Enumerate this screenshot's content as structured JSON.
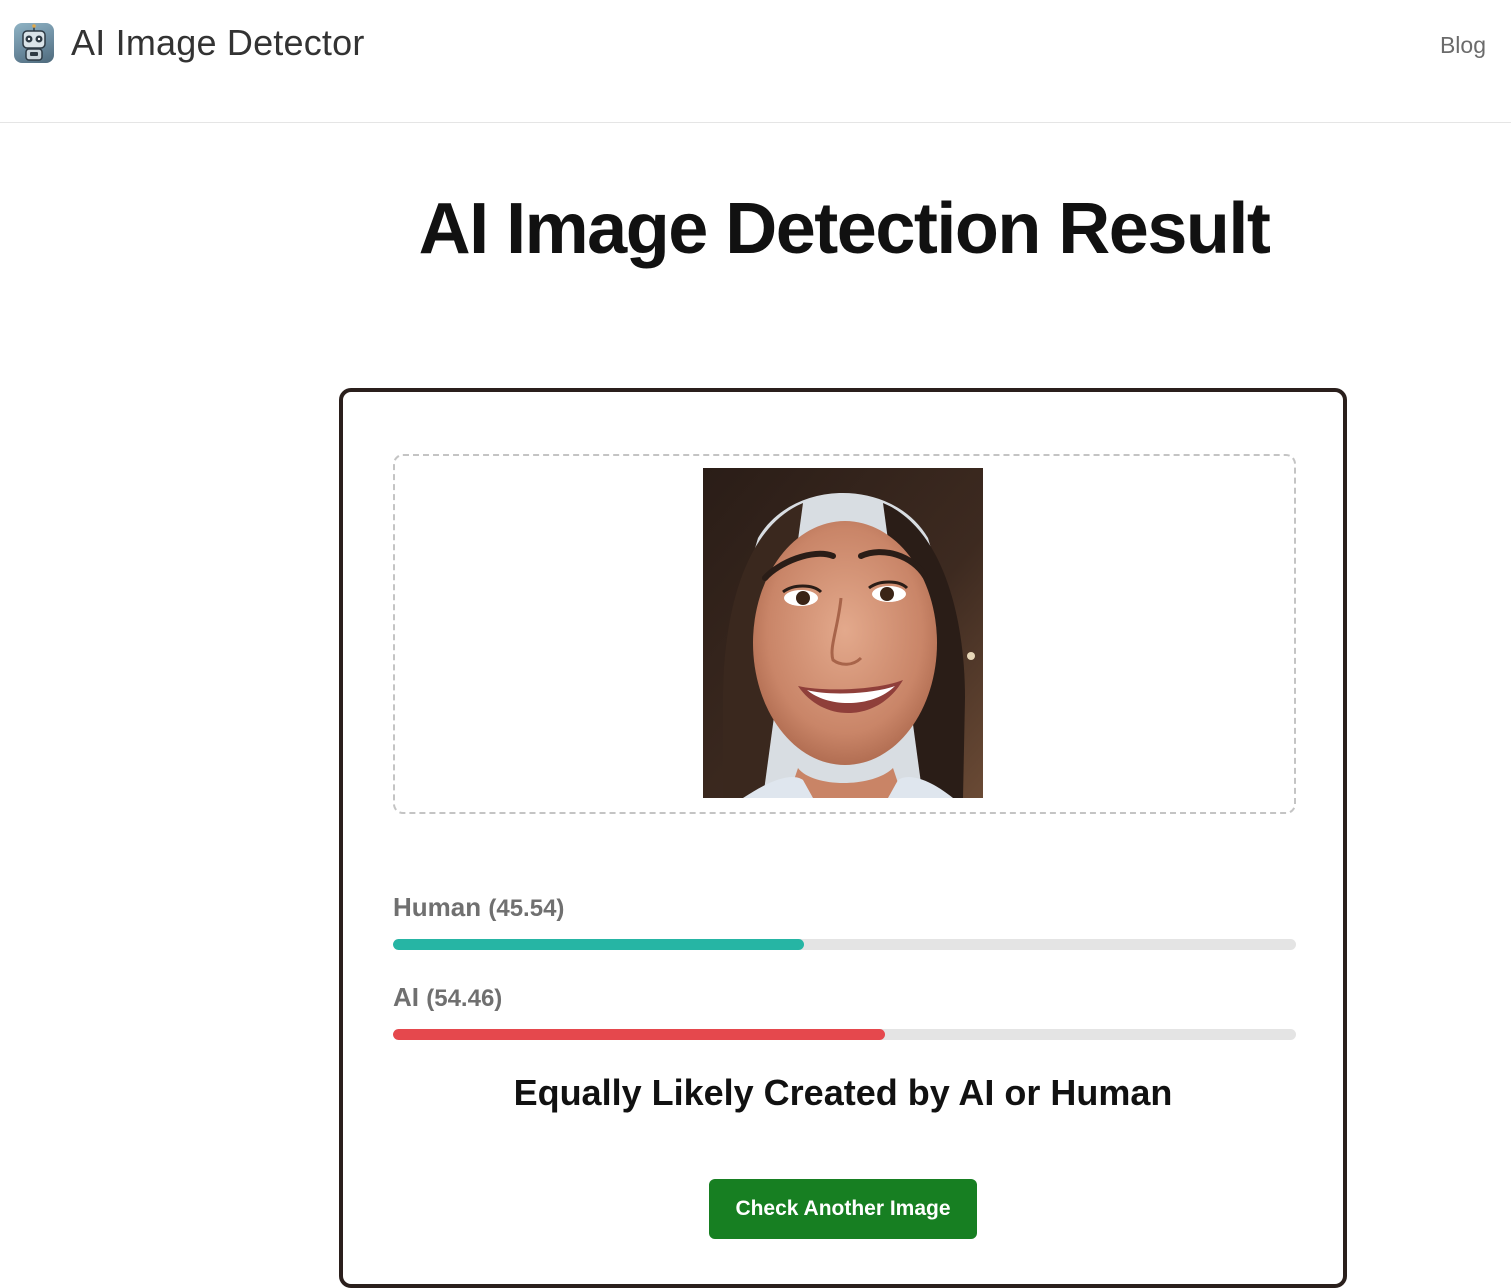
{
  "header": {
    "logo_icon": "robot-icon",
    "brand_name": "AI Image Detector",
    "nav": {
      "blog_label": "Blog"
    }
  },
  "main": {
    "title": "AI Image Detection Result",
    "preview": {
      "image": "uploaded-portrait-photo"
    },
    "scores": [
      {
        "label": "Human",
        "value_text": "(45.54)",
        "value": 45.54,
        "color": "#26b5a4"
      },
      {
        "label": "AI",
        "value_text": "(54.46)",
        "value": 54.46,
        "color": "#e5484d"
      }
    ],
    "verdict": "Equally Likely Created by AI or Human",
    "action_button": "Check Another Image"
  }
}
